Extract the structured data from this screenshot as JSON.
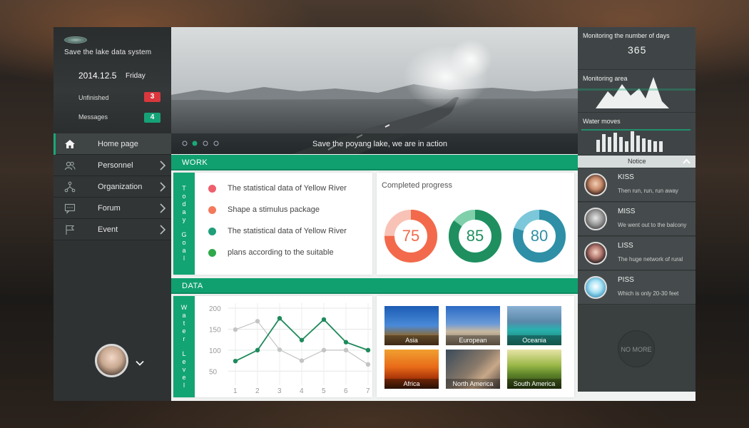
{
  "sidebar": {
    "app_title": "Save the lake data  system",
    "date": "2014.12.5",
    "weekday": "Friday",
    "unfinished_label": "Unfinished",
    "unfinished_count": "3",
    "messages_label": "Messages",
    "messages_count": "4",
    "nav": [
      {
        "label": "Home page",
        "icon": "home-icon",
        "active": true
      },
      {
        "label": "Personnel",
        "icon": "people-icon"
      },
      {
        "label": "Organization",
        "icon": "organization-icon"
      },
      {
        "label": "Forum",
        "icon": "forum-icon"
      },
      {
        "label": "Event",
        "icon": "flag-icon"
      }
    ]
  },
  "banner": {
    "caption": "Save the poyang lake, we are in action",
    "slides": 4,
    "active_slide": 1
  },
  "monitor": {
    "days_title": "Monitoring the number of days",
    "days_value": "365",
    "area_title": "Monitoring area",
    "water_title": "Water moves"
  },
  "notice": {
    "title": "Notice",
    "items": [
      {
        "name": "KISS",
        "message": "Then run, run, run away"
      },
      {
        "name": "MISS",
        "message": "We went out to the balcony"
      },
      {
        "name": "LISS",
        "message": "The huge network of rural"
      },
      {
        "name": "PISS",
        "message": "Which is only 20-30 feet"
      }
    ],
    "no_more": "NO MORE"
  },
  "work": {
    "section": "WORK",
    "goal_tab": "Today Goal",
    "goals": [
      {
        "text": "The statistical data of Yellow River",
        "color": "#ef5f6c"
      },
      {
        "text": "Shape a stimulus package",
        "color": "#f4795c"
      },
      {
        "text": "The statistical data of Yellow River",
        "color": "#1f9e7a"
      },
      {
        "text": "plans according to the suitable",
        "color": "#2fa84a"
      }
    ],
    "progress_title": "Completed progress",
    "progress": [
      {
        "value": 75,
        "color": "#f26a4b",
        "track": "#f8c3b6"
      },
      {
        "value": 85,
        "color": "#1f8f5f",
        "track": "#7fd0aa"
      },
      {
        "value": 80,
        "color": "#2f8fa6",
        "track": "#7cc8da"
      }
    ]
  },
  "data": {
    "section": "DATA",
    "chart_tab": "Water Level",
    "regions": [
      "Asia",
      "European",
      "Oceania",
      "Africa",
      "North America",
      "South America"
    ]
  },
  "chart_data": {
    "type": "line",
    "x": [
      1,
      2,
      3,
      4,
      5,
      6,
      7
    ],
    "ylim": [
      25,
      212
    ],
    "yticks": [
      50,
      100,
      150,
      200
    ],
    "series": [
      {
        "values": [
          74,
          100,
          176,
          124,
          173,
          119,
          100
        ],
        "color": "#1f8a5c"
      },
      {
        "values": [
          149,
          169,
          101,
          75,
          100,
          100,
          66
        ],
        "color": "#c4c4c4"
      }
    ],
    "grid": true
  }
}
